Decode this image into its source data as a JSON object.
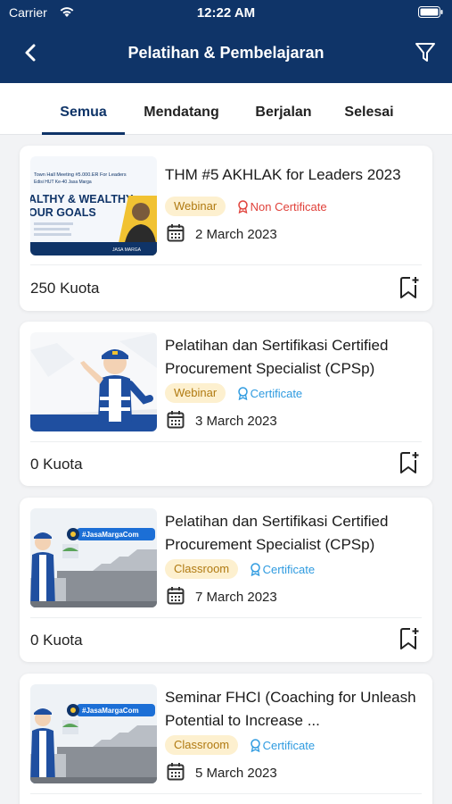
{
  "status_bar": {
    "carrier": "Carrier",
    "time": "12:22 AM"
  },
  "header": {
    "title": "Pelatihan & Pembelajaran"
  },
  "tabs": [
    {
      "label": "Semua",
      "active": true
    },
    {
      "label": "Mendatang",
      "active": false
    },
    {
      "label": "Berjalan",
      "active": false
    },
    {
      "label": "Selesai",
      "active": false
    }
  ],
  "thumbnails": {
    "banner1": {
      "line1": "Town Hall Meeting #5.000.ER For Leaders",
      "line2": "Edisi HUT Ke-40 Jasa Marga",
      "big1": "ALTHY & WEALTHY",
      "big2": "OUR GOALS",
      "footer": "JASA MARGA"
    },
    "banner_hashtag": "#JasaMargaCom"
  },
  "colors": {
    "primary": "#0f3468",
    "tag_bg": "#fdf0cf",
    "tag_text": "#b07a11",
    "non_cert": "#e0413a",
    "cert": "#2f9be0"
  },
  "cards": [
    {
      "title": "THM #5 AKHLAK for Leaders 2023",
      "tag": "Webinar",
      "certificate": "Non Certificate",
      "date": "2 March 2023",
      "quota": "250 Kuota"
    },
    {
      "title": "Pelatihan dan Sertifikasi Certified Procurement Specialist (CPSp)",
      "tag": "Webinar",
      "certificate": "Certificate",
      "date": "3 March 2023",
      "quota": "0 Kuota"
    },
    {
      "title": "Pelatihan dan Sertifikasi Certified Procurement Specialist (CPSp)",
      "tag": "Classroom",
      "certificate": "Certificate",
      "date": "7 March 2023",
      "quota": "0 Kuota"
    },
    {
      "title": "Seminar FHCI (Coaching for Unleash Potential to Increase ...",
      "tag": "Classroom",
      "certificate": "Certificate",
      "date": "5 March 2023",
      "quota": ""
    }
  ]
}
